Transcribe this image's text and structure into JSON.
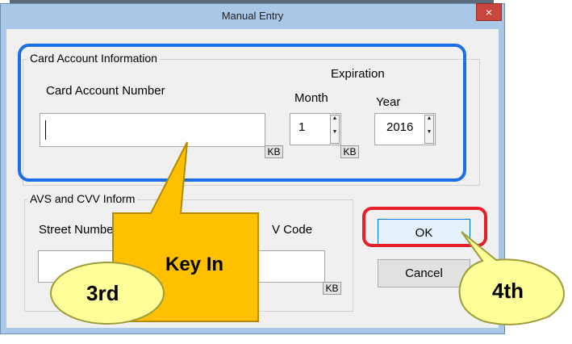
{
  "window": {
    "title": "Manual Entry",
    "close_glyph": "×"
  },
  "card_section": {
    "group_label": "Card Account Information",
    "account_number_label": "Card Account Number",
    "account_number_value": "",
    "kb_label": "KB",
    "expiration_label": "Expiration",
    "month_label": "Month",
    "month_value": "1",
    "year_label": "Year",
    "year_value": "2016"
  },
  "avs_section": {
    "group_label": "AVS and CVV Inform",
    "street_label": "Street Numbe",
    "cvv_label": "V Code",
    "kb_label": "KB"
  },
  "buttons": {
    "ok": "OK",
    "cancel": "Cancel"
  },
  "annotations": {
    "key_in": "Key In",
    "step3": "3rd",
    "step4": "4th",
    "callout_fill": "#ffc000",
    "bubble_fill": "#ffff99",
    "highlight_blue": "#1a6ee8",
    "highlight_red": "#e5202b"
  }
}
